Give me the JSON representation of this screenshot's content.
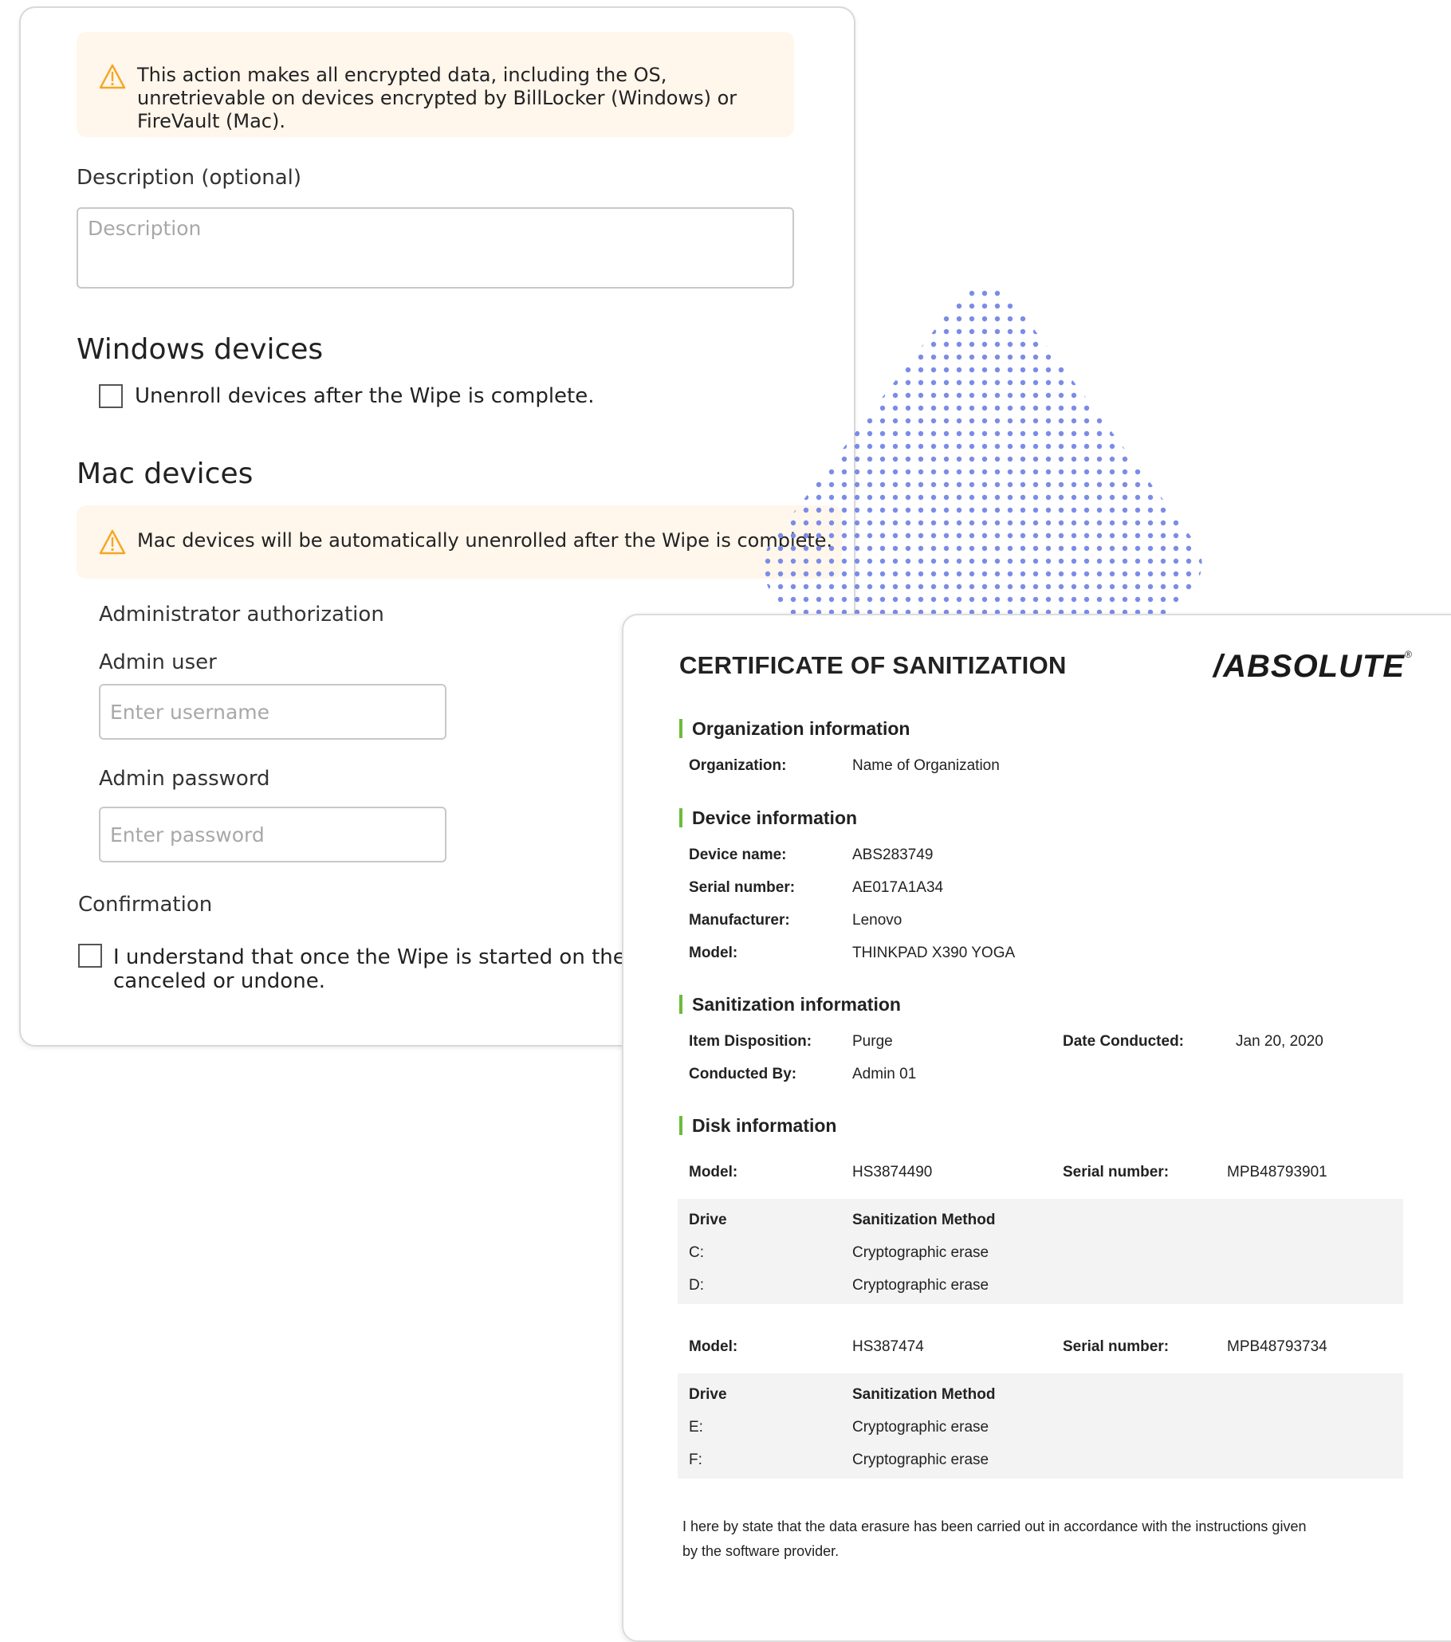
{
  "wipe_form": {
    "encryption_warning": "This action makes all encrypted data, including the OS, unretrievable on devices encrypted by BillLocker (Windows) or FireVault (Mac).",
    "description_label": "Description (optional)",
    "description_placeholder": "Description",
    "windows_section_title": "Windows devices",
    "unenroll_checkbox_label": "Unenroll devices after the Wipe is complete.",
    "mac_section_title": "Mac devices",
    "mac_warning": "Mac devices will be automatically unenrolled after the Wipe is complete.",
    "admin_auth_title": "Administrator authorization",
    "admin_user_label": "Admin user",
    "admin_user_placeholder": "Enter username",
    "admin_password_label": "Admin password",
    "admin_password_placeholder": "Enter password",
    "confirmation_title": "Confirmation",
    "confirmation_line1": "I understand that once the Wipe is started on the device",
    "confirmation_line2": "canceled or undone."
  },
  "certificate": {
    "title": "CERTIFICATE OF SANITIZATION",
    "brand": "/ABSOLUTE",
    "brand_mark": "®",
    "organization_section": "Organization information",
    "organization_label": "Organization:",
    "organization_value": "Name of Organization",
    "device_section": "Device information",
    "device_rows": [
      {
        "label": "Device name:",
        "value": "ABS283749"
      },
      {
        "label": "Serial number:",
        "value": "AE017A1A34"
      },
      {
        "label": "Manufacturer:",
        "value": "Lenovo"
      },
      {
        "label": "Model:",
        "value": "THINKPAD X390 YOGA"
      }
    ],
    "sanitization_section": "Sanitization information",
    "item_disposition_label": "Item Disposition:",
    "item_disposition_value": "Purge",
    "date_conducted_label": "Date Conducted:",
    "date_conducted_value": "Jan 20, 2020",
    "conducted_by_label": "Conducted By:",
    "conducted_by_value": "Admin 01",
    "disk_section": "Disk information",
    "disks": [
      {
        "model_label": "Model:",
        "model": "HS3874490",
        "serial_label": "Serial number:",
        "serial": "MPB48793901",
        "drive_header": "Drive",
        "method_header": "Sanitization Method",
        "drives": [
          {
            "drive": "C:",
            "method": "Cryptographic erase"
          },
          {
            "drive": "D:",
            "method": "Cryptographic erase"
          }
        ]
      },
      {
        "model_label": "Model:",
        "model": "HS387474",
        "serial_label": "Serial number:",
        "serial": "MPB48793734",
        "drive_header": "Drive",
        "method_header": "Sanitization Method",
        "drives": [
          {
            "drive": "E:",
            "method": "Cryptographic erase"
          },
          {
            "drive": "F:",
            "method": "Cryptographic erase"
          }
        ]
      }
    ],
    "statement_line1": "I here by state that the data erasure has been carried out in accordance with the instructions given",
    "statement_line2": "by the software provider."
  },
  "colors": {
    "warning_bg": "#fff6ec",
    "warning_icon": "#f5a623",
    "section_accent": "#6cbb3c",
    "dot_color": "#7b8ce6"
  }
}
